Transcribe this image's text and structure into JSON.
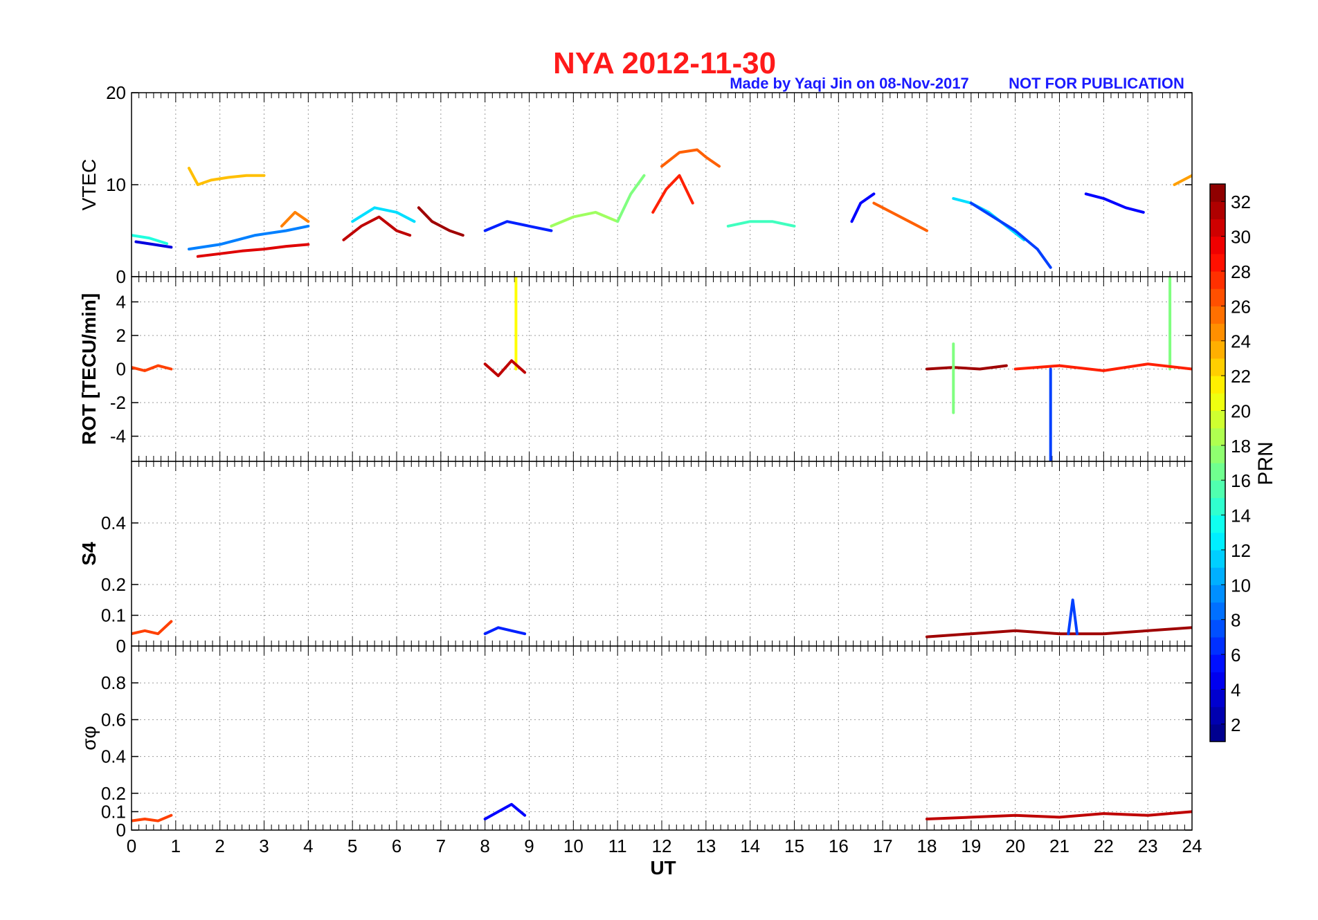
{
  "figure": {
    "title": "NYA   2012-11-30",
    "credit": "Made by Yaqi Jin on 08-Nov-2017",
    "notice": "NOT FOR PUBLICATION",
    "title_color": "#ff1a1a",
    "note_color": "#1a1aff"
  },
  "colorbar": {
    "label": "PRN",
    "min": 1,
    "max": 33,
    "ticks": [
      "2",
      "4",
      "6",
      "8",
      "10",
      "12",
      "14",
      "16",
      "18",
      "20",
      "22",
      "24",
      "26",
      "28",
      "30",
      "32"
    ],
    "colormap": "jet"
  },
  "chart_data": [
    {
      "type": "line",
      "panel": "vtec",
      "ylabel": "VTEC",
      "xlim": [
        0,
        24
      ],
      "ylim": [
        0,
        20
      ],
      "yticks": [
        "0",
        "10",
        "20"
      ],
      "grid": true,
      "series": [
        {
          "prn": 23,
          "x": [
            1.3,
            1.5,
            1.8,
            2.2,
            2.6,
            3.0
          ],
          "y": [
            11.8,
            10.0,
            10.5,
            10.8,
            11.0,
            11.0
          ]
        },
        {
          "prn": 4,
          "x": [
            0.1,
            0.5,
            0.9
          ],
          "y": [
            3.8,
            3.5,
            3.2
          ]
        },
        {
          "prn": 14,
          "x": [
            0.0,
            0.4,
            0.8
          ],
          "y": [
            4.5,
            4.2,
            3.6
          ]
        },
        {
          "prn": 30,
          "x": [
            1.5,
            2.0,
            2.5,
            3.0,
            3.5,
            4.0
          ],
          "y": [
            2.2,
            2.5,
            2.8,
            3.0,
            3.3,
            3.5
          ]
        },
        {
          "prn": 9,
          "x": [
            1.3,
            2.0,
            2.8,
            3.5,
            4.0
          ],
          "y": [
            3.0,
            3.5,
            4.5,
            5.0,
            5.5
          ]
        },
        {
          "prn": 25,
          "x": [
            3.4,
            3.7,
            4.0
          ],
          "y": [
            5.5,
            7.0,
            6.0
          ]
        },
        {
          "prn": 31,
          "x": [
            4.8,
            5.2,
            5.6,
            6.0,
            6.3
          ],
          "y": [
            4.0,
            5.5,
            6.5,
            5.0,
            4.5
          ]
        },
        {
          "prn": 12,
          "x": [
            5.0,
            5.5,
            6.0,
            6.4
          ],
          "y": [
            6.0,
            7.5,
            7.0,
            6.0
          ]
        },
        {
          "prn": 32,
          "x": [
            6.5,
            6.8,
            7.2,
            7.5
          ],
          "y": [
            7.5,
            6.0,
            5.0,
            4.5
          ]
        },
        {
          "prn": 6,
          "x": [
            8.0,
            8.5,
            9.0,
            9.5
          ],
          "y": [
            5.0,
            6.0,
            5.5,
            5.0
          ]
        },
        {
          "prn": 18,
          "x": [
            9.5,
            10.0,
            10.5,
            11.0
          ],
          "y": [
            5.5,
            6.5,
            7.0,
            6.0
          ]
        },
        {
          "prn": 17,
          "x": [
            11.0,
            11.3,
            11.6
          ],
          "y": [
            6.0,
            9.0,
            11.0
          ]
        },
        {
          "prn": 28,
          "x": [
            11.8,
            12.1,
            12.4,
            12.7
          ],
          "y": [
            7.0,
            9.5,
            11.0,
            8.0
          ]
        },
        {
          "prn": 26,
          "x": [
            12.0,
            12.4,
            12.8,
            13.0,
            13.3
          ],
          "y": [
            12.0,
            13.5,
            13.8,
            13.0,
            12.0
          ]
        },
        {
          "prn": 15,
          "x": [
            13.5,
            14.0,
            14.5,
            15.0
          ],
          "y": [
            5.5,
            6.0,
            6.0,
            5.5
          ]
        },
        {
          "prn": 5,
          "x": [
            16.3,
            16.5,
            16.8
          ],
          "y": [
            6.0,
            8.0,
            9.0
          ]
        },
        {
          "prn": 26,
          "x": [
            16.8,
            17.2,
            17.6,
            18.0
          ],
          "y": [
            8.0,
            7.0,
            6.0,
            5.0
          ]
        },
        {
          "prn": 12,
          "x": [
            18.6,
            19.0,
            19.4,
            19.8,
            20.2
          ],
          "y": [
            8.5,
            8.0,
            7.0,
            5.5,
            4.0
          ]
        },
        {
          "prn": 7,
          "x": [
            19.0,
            19.5,
            20.0,
            20.5,
            20.8
          ],
          "y": [
            8.0,
            6.5,
            5.0,
            3.0,
            1.0
          ]
        },
        {
          "prn": 5,
          "x": [
            21.6,
            22.0,
            22.5,
            22.9
          ],
          "y": [
            9.0,
            8.5,
            7.5,
            7.0
          ]
        },
        {
          "prn": 24,
          "x": [
            23.6,
            23.8,
            24.0
          ],
          "y": [
            10.0,
            10.5,
            11.0
          ]
        }
      ]
    },
    {
      "type": "line",
      "panel": "rot",
      "ylabel": "ROT [TECU/min]",
      "xlim": [
        0,
        24
      ],
      "ylim": [
        -5.5,
        5.5
      ],
      "yticks": [
        "-4",
        "-2",
        "0",
        "2",
        "4"
      ],
      "grid": true,
      "series": [
        {
          "prn": 27,
          "x": [
            0.0,
            0.3,
            0.6,
            0.9
          ],
          "y": [
            0.1,
            -0.1,
            0.2,
            0.0
          ]
        },
        {
          "prn": 21,
          "x": [
            8.7,
            8.7
          ],
          "y": [
            0.0,
            5.5
          ]
        },
        {
          "prn": 31,
          "x": [
            8.0,
            8.3,
            8.6,
            8.9
          ],
          "y": [
            0.3,
            -0.4,
            0.5,
            -0.2
          ]
        },
        {
          "prn": 32,
          "x": [
            18.0,
            18.6,
            19.2,
            19.8
          ],
          "y": [
            0.0,
            0.1,
            0.0,
            0.2
          ]
        },
        {
          "prn": 17,
          "x": [
            18.6,
            18.6
          ],
          "y": [
            1.5,
            -2.6
          ]
        },
        {
          "prn": 7,
          "x": [
            20.8,
            20.8
          ],
          "y": [
            0.0,
            -5.5
          ]
        },
        {
          "prn": 17,
          "x": [
            23.5,
            23.5
          ],
          "y": [
            0.0,
            5.5
          ]
        },
        {
          "prn": 28,
          "x": [
            20.0,
            21.0,
            22.0,
            23.0,
            24.0
          ],
          "y": [
            0.0,
            0.2,
            -0.1,
            0.3,
            0.0
          ]
        }
      ]
    },
    {
      "type": "line",
      "panel": "s4",
      "ylabel": "S4",
      "xlim": [
        0,
        24
      ],
      "ylim": [
        0,
        0.6
      ],
      "yticks": [
        "0",
        "0.1",
        "0.2",
        "0.4"
      ],
      "grid": true,
      "series": [
        {
          "prn": 27,
          "x": [
            0.0,
            0.3,
            0.6,
            0.9
          ],
          "y": [
            0.04,
            0.05,
            0.04,
            0.08
          ]
        },
        {
          "prn": 6,
          "x": [
            8.0,
            8.3,
            8.6,
            8.9
          ],
          "y": [
            0.04,
            0.06,
            0.05,
            0.04
          ]
        },
        {
          "prn": 32,
          "x": [
            18.0,
            19.0,
            20.0,
            21.0,
            22.0,
            23.0,
            24.0
          ],
          "y": [
            0.03,
            0.04,
            0.05,
            0.04,
            0.04,
            0.05,
            0.06
          ]
        },
        {
          "prn": 7,
          "x": [
            21.2,
            21.3,
            21.4
          ],
          "y": [
            0.04,
            0.15,
            0.04
          ]
        }
      ]
    },
    {
      "type": "line",
      "panel": "sigma_phi",
      "ylabel": "σφ",
      "xlabel": "UT",
      "xlim": [
        0,
        24
      ],
      "ylim": [
        0,
        1.0
      ],
      "yticks": [
        "0",
        "0.1",
        "0.2",
        "0.4",
        "0.6",
        "0.8"
      ],
      "xticks": [
        "0",
        "1",
        "2",
        "3",
        "4",
        "5",
        "6",
        "7",
        "8",
        "9",
        "10",
        "11",
        "12",
        "13",
        "14",
        "15",
        "16",
        "17",
        "18",
        "19",
        "20",
        "21",
        "22",
        "23",
        "24"
      ],
      "grid": true,
      "series": [
        {
          "prn": 27,
          "x": [
            0.0,
            0.3,
            0.6,
            0.9
          ],
          "y": [
            0.05,
            0.06,
            0.05,
            0.08
          ]
        },
        {
          "prn": 5,
          "x": [
            8.0,
            8.3,
            8.6,
            8.9
          ],
          "y": [
            0.06,
            0.1,
            0.14,
            0.08
          ]
        },
        {
          "prn": 31,
          "x": [
            18.0,
            19.0,
            20.0,
            21.0,
            22.0,
            23.0,
            24.0
          ],
          "y": [
            0.06,
            0.07,
            0.08,
            0.07,
            0.09,
            0.08,
            0.1
          ]
        }
      ]
    }
  ]
}
